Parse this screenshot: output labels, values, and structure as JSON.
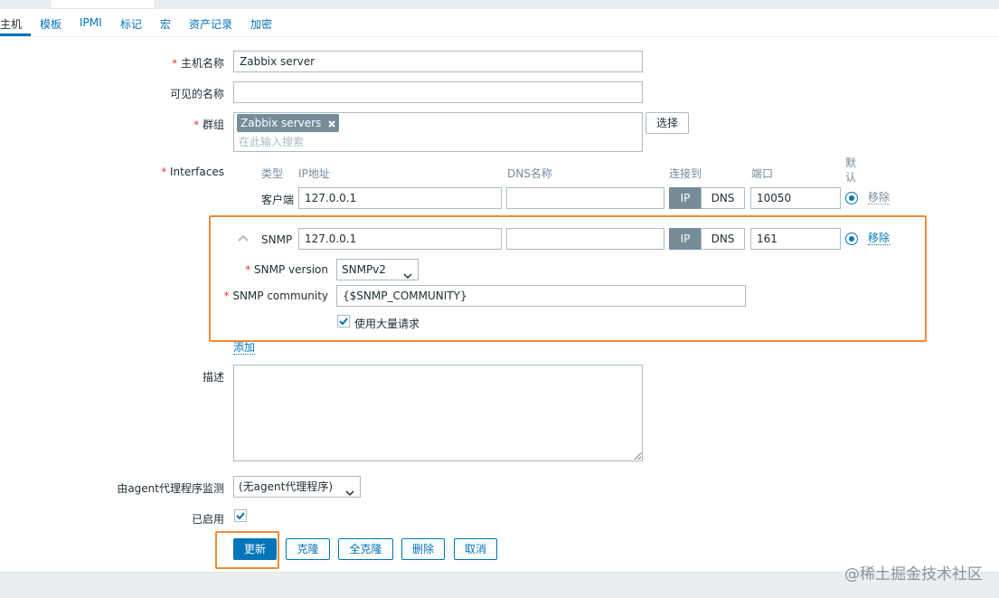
{
  "tabs": [
    "主机",
    "模板",
    "IPMI",
    "标记",
    "宏",
    "资产记录",
    "加密"
  ],
  "form": {
    "host_name": {
      "required_mark": "*",
      "label": "主机名称",
      "value": "Zabbix server"
    },
    "visible_name": {
      "label": "可见的名称",
      "value": ""
    },
    "groups": {
      "required_mark": "*",
      "label": "群组",
      "tag": "Zabbix servers",
      "placeholder": "在此输入搜索",
      "select_button": "选择"
    },
    "interfaces": {
      "required_mark": "*",
      "label": "Interfaces",
      "headers": {
        "type": "类型",
        "ip": "IP地址",
        "dns": "DNS名称",
        "connect": "连接到",
        "port": "端口",
        "default": "默认"
      },
      "agent": {
        "type": "客户端",
        "ip": "127.0.0.1",
        "dns": "",
        "ip_btn": "IP",
        "dns_btn": "DNS",
        "port": "10050",
        "remove": "移除"
      },
      "snmp": {
        "type": "SNMP",
        "ip": "127.0.0.1",
        "dns": "",
        "ip_btn": "IP",
        "dns_btn": "DNS",
        "port": "161",
        "remove": "移除",
        "version_label": "SNMP version",
        "version_value": "SNMPv2",
        "community_label": "SNMP community",
        "community_value": "{$SNMP_COMMUNITY}",
        "bulk_label": "使用大量请求",
        "bulk_checked": true
      },
      "add": "添加"
    },
    "description": {
      "label": "描述",
      "value": ""
    },
    "proxy": {
      "label": "由agent代理程序监测",
      "value": "(无agent代理程序)"
    },
    "enabled": {
      "label": "已启用",
      "checked": true
    }
  },
  "buttons": {
    "update": "更新",
    "clone": "克隆",
    "full_clone": "全克隆",
    "delete": "删除",
    "cancel": "取消"
  },
  "watermark": "@稀土掘金技术社区",
  "colors": {
    "primary": "#0275b8",
    "highlight": "#ef8c35",
    "required": "#e33734",
    "toggle_on": "#768d99"
  }
}
